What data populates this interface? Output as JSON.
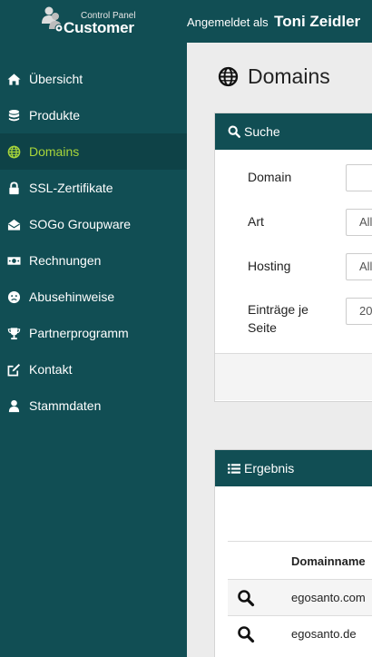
{
  "header": {
    "logo_small": "Control Panel",
    "logo_big": "Customer",
    "login_prefix": "Angemeldet als",
    "user_name": "Toni Zeidler"
  },
  "sidebar": {
    "items": [
      {
        "label": "Übersicht",
        "icon": "home-icon"
      },
      {
        "label": "Produkte",
        "icon": "database-icon"
      },
      {
        "label": "Domains",
        "icon": "globe-icon",
        "active": true
      },
      {
        "label": "SSL-Zertifikate",
        "icon": "lock-icon"
      },
      {
        "label": "SOGo Groupware",
        "icon": "envelope-open-icon"
      },
      {
        "label": "Rechnungen",
        "icon": "money-icon"
      },
      {
        "label": "Abusehinweise",
        "icon": "frown-icon"
      },
      {
        "label": "Partnerprogramm",
        "icon": "trophy-icon"
      },
      {
        "label": "Kontakt",
        "icon": "edit-icon"
      },
      {
        "label": "Stammdaten",
        "icon": "user-icon"
      }
    ]
  },
  "page": {
    "title": "Domains"
  },
  "search": {
    "heading": "Suche",
    "domain_label": "Domain",
    "domain_value": "",
    "type_label": "Art",
    "type_value": "Alle",
    "hosting_label": "Hosting",
    "hosting_value": "Alle",
    "per_page_label_1": "Einträge je",
    "per_page_label_2": "Seite",
    "per_page_value": "20"
  },
  "results": {
    "heading": "Ergebnis",
    "col_domain": "Domainname",
    "rows": [
      {
        "domain": "egosanto.com"
      },
      {
        "domain": "egosanto.de"
      }
    ]
  },
  "colors": {
    "brand": "#114e54",
    "active_text": "#a8d53a",
    "background": "#ececec"
  }
}
